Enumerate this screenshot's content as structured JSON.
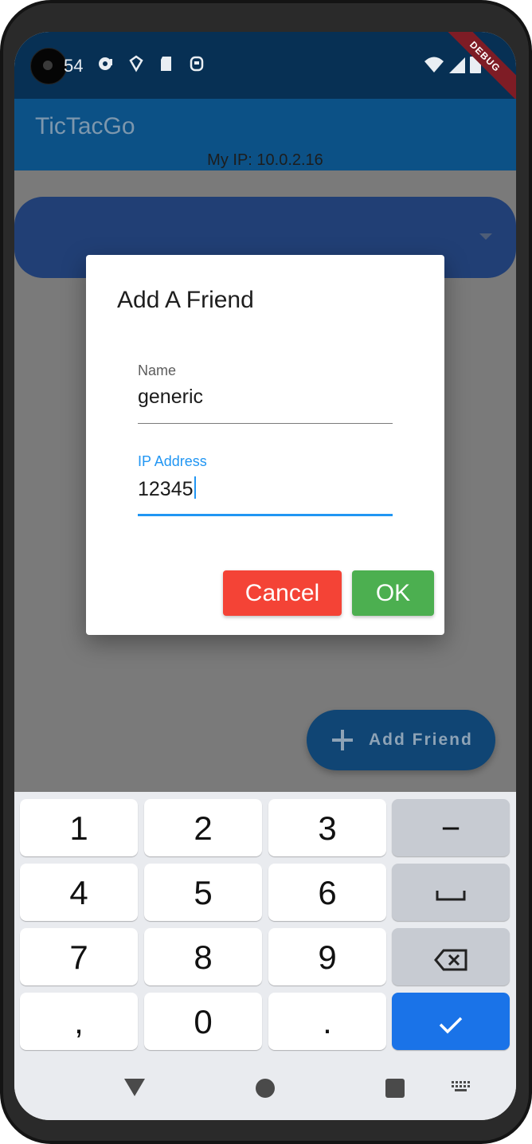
{
  "status_bar": {
    "time": "54",
    "debug_label": "DEBUG"
  },
  "app_bar": {
    "title": "TicTacGo",
    "my_ip": "My IP: 10.0.2.16"
  },
  "dropdown": {
    "value": ""
  },
  "fab": {
    "label": "Add Friend",
    "icon": "plus-icon"
  },
  "dialog": {
    "title": "Add A Friend",
    "name_field": {
      "label": "Name",
      "value": "generic"
    },
    "ip_field": {
      "label": "IP Address",
      "value": "12345"
    },
    "cancel_label": "Cancel",
    "ok_label": "OK"
  },
  "keyboard": {
    "keys": [
      "1",
      "2",
      "3",
      "−",
      "4",
      "5",
      "6",
      "7",
      "8",
      "9",
      ",",
      "0",
      "."
    ],
    "icons": [
      "space-icon",
      "backspace-icon",
      "checkmark-icon"
    ]
  },
  "colors": {
    "primary": "#0c5186",
    "accent": "#2196f3",
    "cancel": "#f44336",
    "ok": "#4caf50",
    "keyboard_enter": "#1a73e8"
  }
}
